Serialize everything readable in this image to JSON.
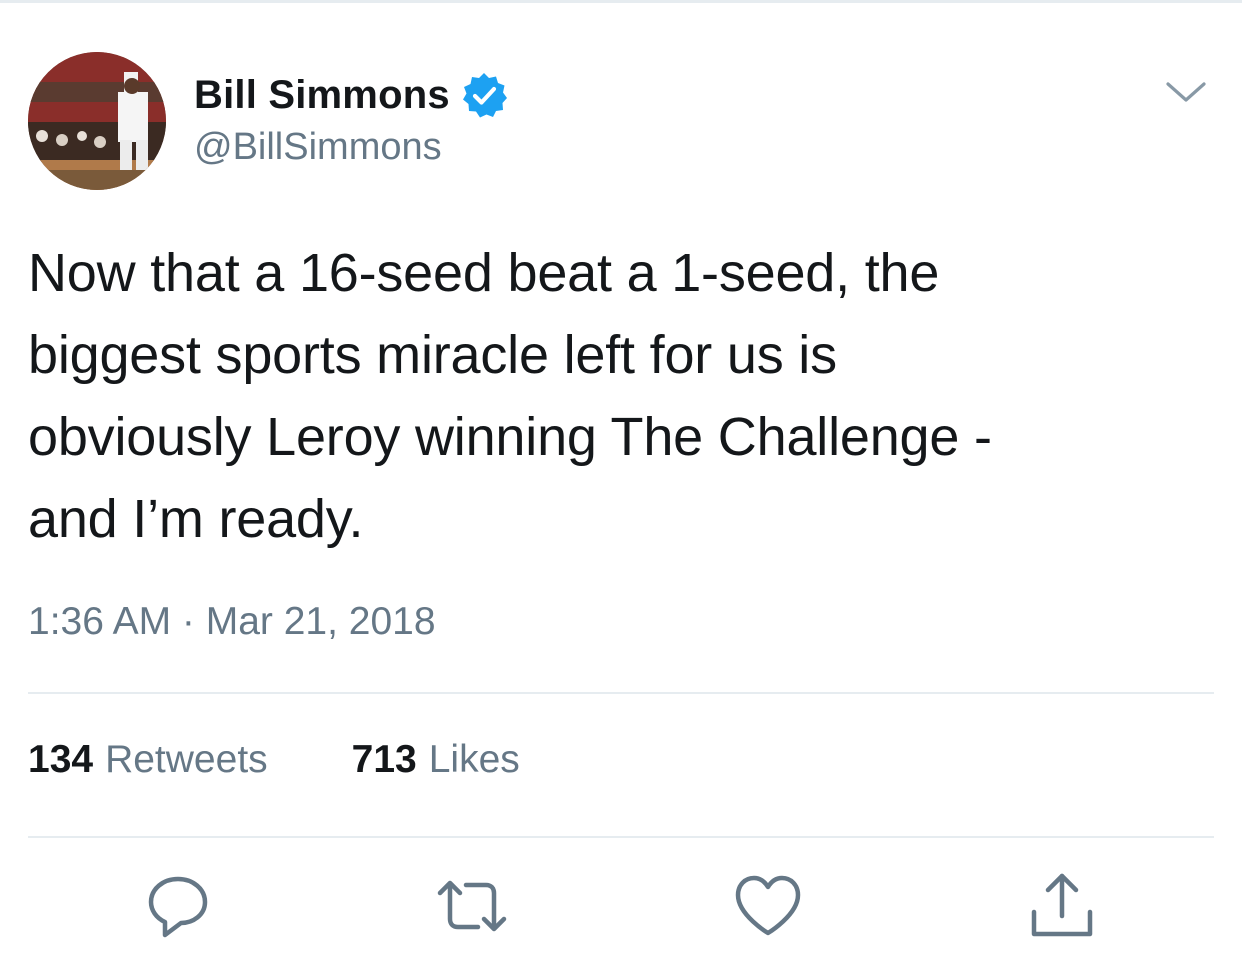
{
  "tweet": {
    "author": {
      "display_name": "Bill Simmons",
      "handle": "@BillSimmons",
      "verified": true,
      "avatar_icon": "avatar-photo"
    },
    "text": "Now that a 16-seed beat a 1-seed, the\nbiggest sports miracle left for us is\nobviously Leroy winning The Challenge -\nand I’m ready.",
    "timestamp": "1:36 AM · Mar 21, 2018",
    "stats": {
      "retweets_count": "134",
      "retweets_label": "Retweets",
      "likes_count": "713",
      "likes_label": "Likes"
    },
    "actions": [
      {
        "name": "reply",
        "icon": "reply-icon"
      },
      {
        "name": "retweet",
        "icon": "retweet-icon"
      },
      {
        "name": "like",
        "icon": "heart-icon"
      },
      {
        "name": "share",
        "icon": "share-icon"
      }
    ]
  },
  "colors": {
    "text_primary": "#14171a",
    "text_secondary": "#657786",
    "verified_blue": "#1da1f2",
    "divider": "#e6ecf0"
  }
}
